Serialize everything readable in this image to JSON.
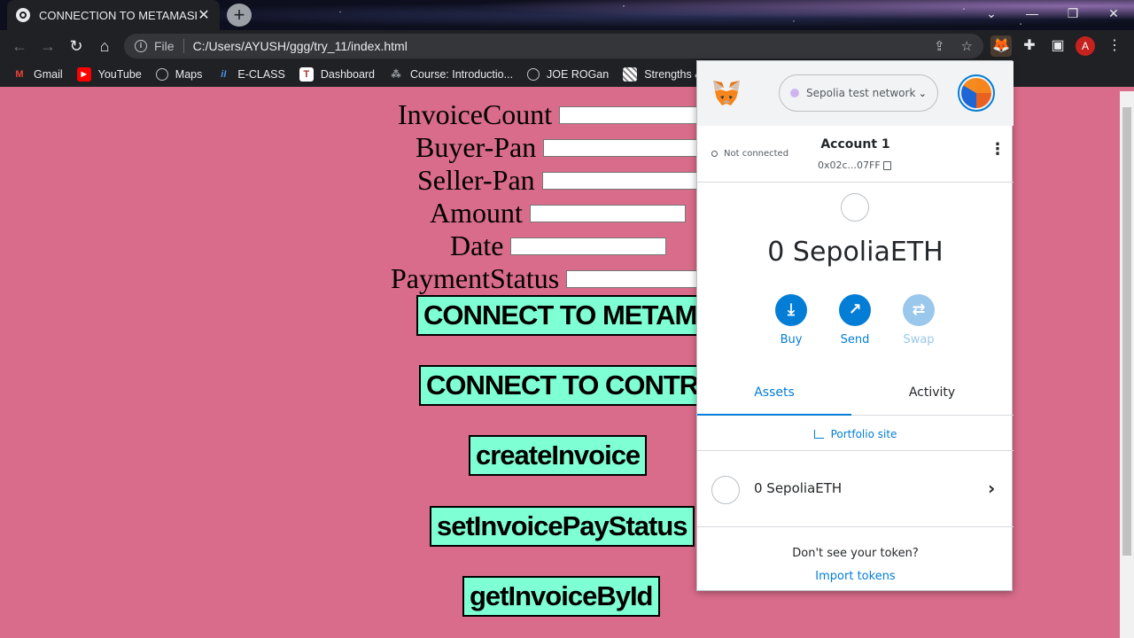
{
  "browser": {
    "tab_title": "CONNECTION TO METAMASK",
    "tab_close": "✕",
    "new_tab": "+",
    "scheme": "File",
    "url": "C:/Users/AYUSH/ggg/try_11/index.html",
    "profile_initial": "A",
    "bookmarks": [
      {
        "label": "Gmail",
        "icon": "gmail-icon"
      },
      {
        "label": "YouTube",
        "icon": "youtube-icon"
      },
      {
        "label": "Maps",
        "icon": "globe-icon"
      },
      {
        "label": "E-CLASS",
        "icon": "eclass-icon"
      },
      {
        "label": "Dashboard",
        "icon": "dashboard-icon"
      },
      {
        "label": "Course: Introductio...",
        "icon": "course-icon"
      },
      {
        "label": "JOE ROGan",
        "icon": "globe-icon"
      },
      {
        "label": "Strengths & Wea",
        "icon": "strengths-icon"
      }
    ]
  },
  "form": {
    "fields": [
      {
        "label": "InvoiceCount",
        "value": ""
      },
      {
        "label": "Buyer-Pan",
        "value": ""
      },
      {
        "label": "Seller-Pan",
        "value": ""
      },
      {
        "label": "Amount",
        "value": ""
      },
      {
        "label": "Date",
        "value": ""
      },
      {
        "label": "PaymentStatus",
        "value": ""
      }
    ],
    "buttons": {
      "connect_metamask": "CONNECT TO METAMASK",
      "connect_contract": "CONNECT TO CONTRACT",
      "create_invoice": "createInvoice",
      "set_pay_status": "setInvoicePayStatus",
      "get_invoice": "getInvoiceById"
    }
  },
  "metamask": {
    "network": "Sepolia test network",
    "connection_status": "Not connected",
    "account_name": "Account 1",
    "account_address": "0x02c...07FF",
    "balance": "0 SepoliaETH",
    "actions": {
      "buy": "Buy",
      "send": "Send",
      "swap": "Swap"
    },
    "tabs": {
      "assets": "Assets",
      "activity": "Activity"
    },
    "portfolio_link": "Portfolio site",
    "asset_row": "0 SepoliaETH",
    "no_token_text": "Don't see your token?",
    "import_tokens": "Import tokens",
    "colors": {
      "accent": "#037dd6",
      "network_dot": "#cfb5f0"
    }
  },
  "colors": {
    "page_bg": "#d96c8a",
    "button_bg": "#7fffd4"
  }
}
